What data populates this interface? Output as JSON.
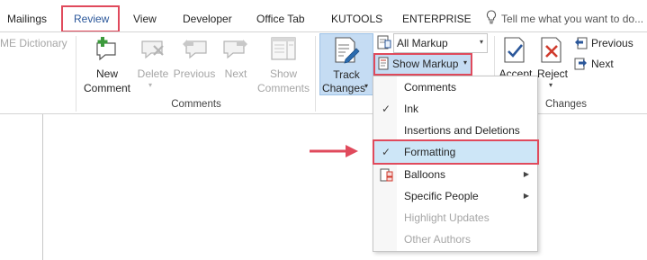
{
  "tabs": [
    {
      "label": "Mailings"
    },
    {
      "label": "Review"
    },
    {
      "label": "View"
    },
    {
      "label": "Developer"
    },
    {
      "label": "Office Tab"
    },
    {
      "label": "KUTOOLS"
    },
    {
      "label": "ENTERPRISE"
    }
  ],
  "tell_me": {
    "placeholder": "Tell me what you want to do..."
  },
  "ribbon": {
    "left_cutoff_label": "ME Dictionary",
    "comments_group": {
      "label": "Comments",
      "buttons": [
        {
          "line1": "New",
          "line2": "Comment",
          "enabled": true
        },
        {
          "line1": "Delete",
          "line2": "",
          "enabled": false
        },
        {
          "line1": "Previous",
          "line2": "",
          "enabled": false
        },
        {
          "line1": "Next",
          "line2": "",
          "enabled": false
        },
        {
          "line1": "Show",
          "line2": "Comments",
          "enabled": false
        }
      ]
    },
    "tracking_group": {
      "track_changes": {
        "line1": "Track",
        "line2": "Changes"
      },
      "markup_select": {
        "value": "All Markup"
      },
      "show_markup": {
        "label": "Show Markup"
      }
    },
    "changes_group": {
      "label": "Changes",
      "accept": {
        "label": "Accept"
      },
      "reject": {
        "label": "Reject"
      },
      "previous": {
        "label": "Previous"
      },
      "next": {
        "label": "Next"
      }
    }
  },
  "show_markup_menu": {
    "items": [
      {
        "label": "Comments",
        "checked": false,
        "submenu": false,
        "enabled": true,
        "highlighted": false
      },
      {
        "label": "Ink",
        "checked": true,
        "submenu": false,
        "enabled": true,
        "highlighted": false
      },
      {
        "label": "Insertions and Deletions",
        "checked": false,
        "submenu": false,
        "enabled": true,
        "highlighted": false
      },
      {
        "label": "Formatting",
        "checked": true,
        "submenu": false,
        "enabled": true,
        "highlighted": true
      },
      {
        "label": "Balloons",
        "checked": false,
        "submenu": true,
        "enabled": true,
        "highlighted": false
      },
      {
        "label": "Specific People",
        "checked": false,
        "submenu": true,
        "enabled": true,
        "highlighted": false
      },
      {
        "label": "Highlight Updates",
        "checked": false,
        "submenu": false,
        "enabled": false,
        "highlighted": false
      },
      {
        "label": "Other Authors",
        "checked": false,
        "submenu": false,
        "enabled": false,
        "highlighted": false
      }
    ]
  },
  "colors": {
    "accent_blue": "#2b579a",
    "annotation_red": "#e04a5c",
    "menu_highlight": "#cde6f7",
    "ribbon_selected": "#c5dcf3"
  }
}
